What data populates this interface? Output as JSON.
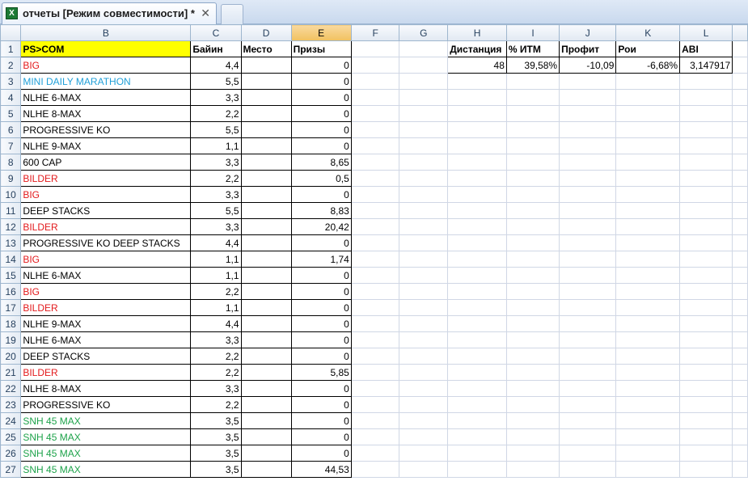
{
  "tab": {
    "title": "отчеты  [Режим совместимости] *",
    "close": "✕",
    "icon_label": "X"
  },
  "colors": {
    "red": "#e31a1c",
    "blue": "#1f9fd8",
    "green": "#1ea34b",
    "highlight": "#ffff00"
  },
  "columns": [
    "B",
    "C",
    "D",
    "E",
    "F",
    "G",
    "H",
    "I",
    "J",
    "K",
    "L"
  ],
  "header_row": {
    "B": "PS>COM",
    "C": "Байин",
    "D": "Место",
    "E": "Призы",
    "H": "Дистанция",
    "I": "% ИТМ",
    "J": "Профит",
    "K": "Рои",
    "L": "ABI"
  },
  "summary": {
    "distance": "48",
    "itm": "39,58%",
    "profit": "-10,09",
    "roi": "-6,68%",
    "abi": "3,147917"
  },
  "rows": [
    {
      "n": "2",
      "name": "BIG",
      "color": "red",
      "buyin": "4,4",
      "place": "",
      "prize": "0"
    },
    {
      "n": "3",
      "name": "MINI DAILY MARATHON",
      "color": "blue",
      "buyin": "5,5",
      "place": "",
      "prize": "0"
    },
    {
      "n": "4",
      "name": "NLHE 6-MAX",
      "color": "black",
      "buyin": "3,3",
      "place": "",
      "prize": "0"
    },
    {
      "n": "5",
      "name": "NLHE 8-MAX",
      "color": "black",
      "buyin": "2,2",
      "place": "",
      "prize": "0"
    },
    {
      "n": "6",
      "name": "PROGRESSIVE KO",
      "color": "black",
      "buyin": "5,5",
      "place": "",
      "prize": "0"
    },
    {
      "n": "7",
      "name": "NLHE 9-MAX",
      "color": "black",
      "buyin": "1,1",
      "place": "",
      "prize": "0"
    },
    {
      "n": "8",
      "name": "600 CAP",
      "color": "black",
      "buyin": "3,3",
      "place": "",
      "prize": "8,65"
    },
    {
      "n": "9",
      "name": "BILDER",
      "color": "red",
      "buyin": "2,2",
      "place": "",
      "prize": "0,5"
    },
    {
      "n": "10",
      "name": "BIG",
      "color": "red",
      "buyin": "3,3",
      "place": "",
      "prize": "0"
    },
    {
      "n": "11",
      "name": "DEEP STACKS",
      "color": "black",
      "buyin": "5,5",
      "place": "",
      "prize": "8,83"
    },
    {
      "n": "12",
      "name": "BILDER",
      "color": "red",
      "buyin": "3,3",
      "place": "",
      "prize": "20,42"
    },
    {
      "n": "13",
      "name": "PROGRESSIVE KO DEEP STACKS",
      "color": "black",
      "buyin": "4,4",
      "place": "",
      "prize": "0"
    },
    {
      "n": "14",
      "name": "BIG",
      "color": "red",
      "buyin": "1,1",
      "place": "",
      "prize": "1,74"
    },
    {
      "n": "15",
      "name": "NLHE 6-MAX",
      "color": "black",
      "buyin": "1,1",
      "place": "",
      "prize": "0"
    },
    {
      "n": "16",
      "name": "BIG",
      "color": "red",
      "buyin": "2,2",
      "place": "",
      "prize": "0"
    },
    {
      "n": "17",
      "name": "BILDER",
      "color": "red",
      "buyin": "1,1",
      "place": "",
      "prize": "0"
    },
    {
      "n": "18",
      "name": "NLHE 9-MAX",
      "color": "black",
      "buyin": "4,4",
      "place": "",
      "prize": "0"
    },
    {
      "n": "19",
      "name": "NLHE 6-MAX",
      "color": "black",
      "buyin": "3,3",
      "place": "",
      "prize": "0"
    },
    {
      "n": "20",
      "name": "DEEP STACKS",
      "color": "black",
      "buyin": "2,2",
      "place": "",
      "prize": "0"
    },
    {
      "n": "21",
      "name": "BILDER",
      "color": "red",
      "buyin": "2,2",
      "place": "",
      "prize": "5,85"
    },
    {
      "n": "22",
      "name": "NLHE 8-MAX",
      "color": "black",
      "buyin": "3,3",
      "place": "",
      "prize": "0"
    },
    {
      "n": "23",
      "name": "PROGRESSIVE KO",
      "color": "black",
      "buyin": "2,2",
      "place": "",
      "prize": "0"
    },
    {
      "n": "24",
      "name": "SNH 45 MAX",
      "color": "green",
      "buyin": "3,5",
      "place": "",
      "prize": "0"
    },
    {
      "n": "25",
      "name": "SNH 45 MAX",
      "color": "green",
      "buyin": "3,5",
      "place": "",
      "prize": "0"
    },
    {
      "n": "26",
      "name": "SNH 45 MAX",
      "color": "green",
      "buyin": "3,5",
      "place": "",
      "prize": "0"
    },
    {
      "n": "27",
      "name": "SNH 45 MAX",
      "color": "green",
      "buyin": "3,5",
      "place": "",
      "prize": "44,53"
    }
  ]
}
